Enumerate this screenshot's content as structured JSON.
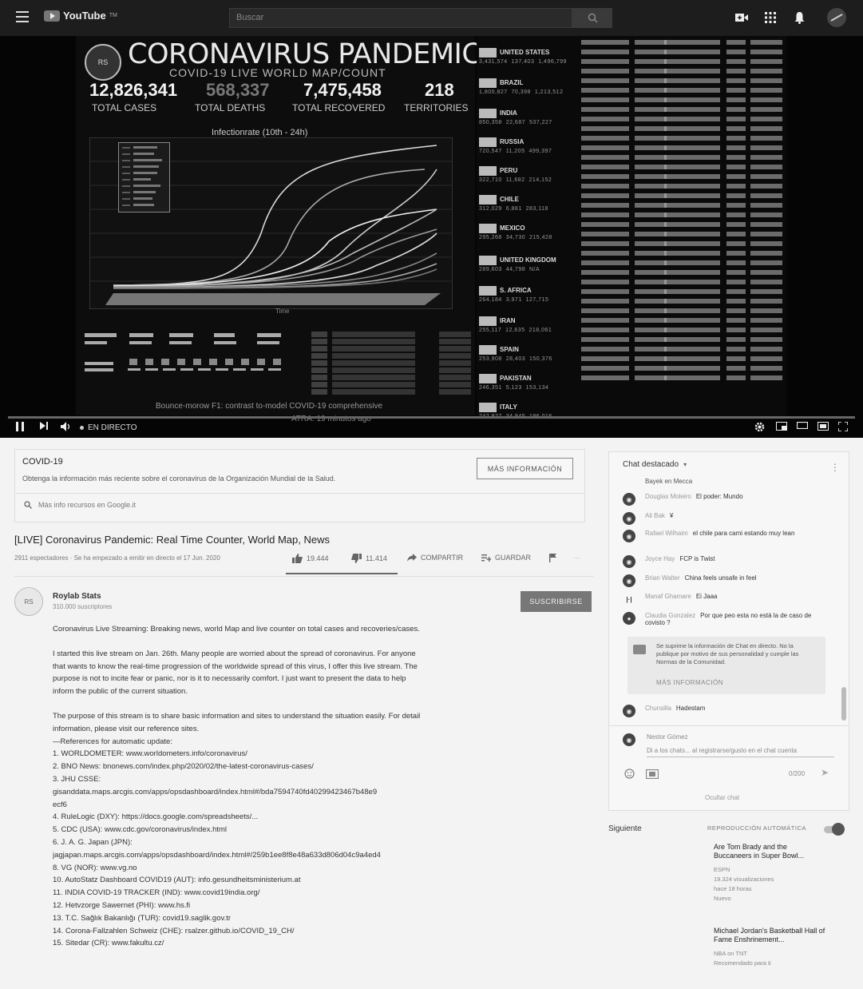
{
  "topbar": {
    "logo_text": "YouTube",
    "logo_sup": "TM",
    "search_placeholder": "Buscar",
    "icons": [
      "menu-icon",
      "search-icon",
      "video-camera-icon",
      "apps-grid-icon",
      "bell-icon",
      "avatar"
    ]
  },
  "video": {
    "dashboard_title": "CORONAVIRUS PANDEMIC",
    "dashboard_subtitle": "COVID-19 LIVE WORLD MAP/COUNT",
    "stats": [
      {
        "value": "12,826,341",
        "label": "TOTAL CASES"
      },
      {
        "value": "568,337",
        "label": "TOTAL DEATHS"
      },
      {
        "value": "7,475,458",
        "label": "TOTAL RECOVERED"
      },
      {
        "value": "218",
        "label": "TERRITORIES"
      }
    ],
    "graph_title": "Infectionrate (10th - 24h)",
    "graph_xlabel": "Time",
    "countries": [
      "UNITED STATES",
      "BRAZIL",
      "INDIA",
      "RUSSIA",
      "PERU",
      "CHILE",
      "MEXICO",
      "UNITED KINGDOM",
      "S. AFRICA",
      "IRAN",
      "SPAIN",
      "PAKISTAN",
      "ITALY"
    ],
    "caption": "Bounce-morow F1: contrast to-model COVID-19 comprehensive",
    "caption2": "ATRA: 19 minutos ago",
    "controls": {
      "live_label": "EN DIRECTO",
      "icons": [
        "pause-icon",
        "next-icon",
        "volume-icon",
        "settings-icon",
        "miniplayer-icon",
        "theater-icon",
        "cast-icon",
        "fullscreen-icon"
      ]
    }
  },
  "covid_panel": {
    "title": "COVID-19",
    "description": "Obtenga la información más reciente sobre el coronavirus de la Organización Mundial de la Salud.",
    "button": "MÁS INFORMACIÓN",
    "search_link": "Más info recursos en Google.it"
  },
  "meta": {
    "title": "[LIVE] Coronavirus Pandemic: Real Time Counter, World Map, News",
    "subline": "2911 espectadores · Se ha empezado a emitir en directo el 17 Jun. 2020",
    "likes": "19.444",
    "dislikes": "11.414",
    "share": "COMPARTIR",
    "save": "GUARDAR",
    "flag_icon": "flag-icon",
    "more_icon": "more-icon"
  },
  "channel": {
    "name": "Roylab Stats",
    "subs": "310.000 suscriptores",
    "subscribe": "SUSCRIBIRSE"
  },
  "description": {
    "p1": "Coronavirus Live Streaming: Breaking news, world Map and live counter on total cases and recoveries/cases.",
    "p2": "I started this live stream on Jan. 26th. Many people are worried about the spread of coronavirus. For anyone that wants to know the real-time progression of the worldwide spread of this virus, I offer this live stream. The purpose is not to incite fear or panic, nor is it to necessarily comfort. I just want to present the data to help inform the public of the current situation.",
    "p3": "The purpose of this stream is to share basic information and sites to understand the situation easily. For detail information, please visit our reference sites.",
    "refs_header": "—References for automatic update:",
    "refs": [
      "1. WORLDOMETER:  www.worldometers.info/coronavirus/",
      "2. BNO News:  bnonews.com/index.php/2020/02/the-latest-coronavirus-cases/",
      "3. JHU CSSE:",
      "gisanddata.maps.arcgis.com/apps/opsdashboard/index.html#/bda7594740fd40299423467b48e9",
      "ecf6",
      "4. RuleLogic (DXY):  https://docs.google.com/spreadsheets/...",
      "5. CDC (USA):  www.cdc.gov/coronavirus/index.html",
      "6. J. A. G. Japan (JPN):",
      "jagjapan.maps.arcgis.com/apps/opsdashboard/index.html#/259b1ee8f8e48a633d806d04c9a4ed4",
      "8. VG (NOR):  www.vg.no",
      "10. AutoStatz Dashboard COVID19 (AUT):  info.gesundheitsministerium.at",
      "11. INDIA COVID-19 TRACKER (IND):  www.covid19india.org/",
      "12. Hetvzorge Sawernet (PHI):  www.hs.fi",
      "13. T.C. Sağlık Bakanlığı (TUR):  covid19.saglik.gov.tr",
      "14. Corona-Fallzahlen Schweiz (CHE):  rsalzer.github.io/COVID_19_CH/",
      "15. Sitedar (CR):  www.fakultu.cz/"
    ]
  },
  "chat": {
    "header": "Chat destacado",
    "subheader": "Bayek en Mecca",
    "messages": [
      {
        "author": "Douglas Moleiro",
        "text": "El poder: Mundo"
      },
      {
        "author": "Ali Bak",
        "text": "¥"
      },
      {
        "author": "Rafael Wilhaim",
        "text": "el chile para cami estando muy lean"
      },
      {
        "author": "Joyce Hay",
        "text": "FCP is Twist"
      },
      {
        "author": "Brian Walter",
        "text": "China feels unsafe in feel"
      },
      {
        "author": "Manaf Ghamare",
        "text": "Ei Jaaa"
      },
      {
        "author": "Claudia Gonzalez",
        "text": "Por que peo esta no está la de caso de covisto ?"
      },
      {
        "author": "Chunsilla",
        "text": "Hadestam"
      }
    ],
    "notice": "Se suprime la información de Chat en directo. No la publique por motivo de sus personalidad y cumple las Normas de la Comunidad.",
    "notice_link": "MÁS INFORMACIÓN",
    "compose_name": "Nestor Gómez",
    "compose_placeholder": "Di a los chats... al registrarse/gusto en el chat cuenta",
    "counter": "0/200",
    "hide": "Ocultar chat"
  },
  "up_next": {
    "label": "Siguiente",
    "autoplay": "REPRODUCCIÓN AUTOMÁTICA",
    "items": [
      {
        "title": "Are Tom Brady and the Buccaneers in Super Bowl...",
        "channel": "ESPN",
        "views": "19.324 visualizaciones",
        "age": "hace 18 horas",
        "badge": "Nuevo"
      },
      {
        "title": "Michael Jordan's Basketball Hall of Fame Enshrinement...",
        "channel": "NBA on TNT",
        "views": "Recomendado para ti",
        "age": "",
        "badge": ""
      }
    ]
  }
}
